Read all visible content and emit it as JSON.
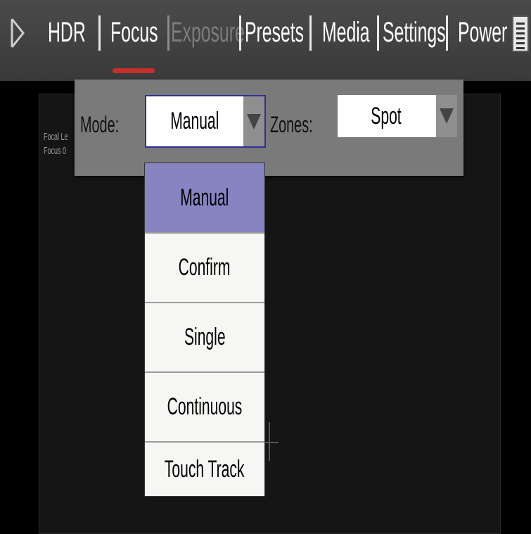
{
  "nav": {
    "items": [
      {
        "label": "HDR",
        "enabled": true
      },
      {
        "label": "Focus",
        "enabled": true,
        "active": true
      },
      {
        "label": "Exposure",
        "enabled": false
      },
      {
        "label": "Presets",
        "enabled": true
      },
      {
        "label": "Media",
        "enabled": true
      },
      {
        "label": "Settings",
        "enabled": true
      },
      {
        "label": "Power",
        "enabled": true
      }
    ],
    "active_indicator_color": "#c4302b"
  },
  "info": {
    "line1": "Focal Le",
    "line2": "Focus 0"
  },
  "panel": {
    "mode_label": "Mode:",
    "mode_value": "Manual",
    "zones_label": "Zones:",
    "zones_value": "Spot"
  },
  "dropdown": {
    "options": [
      "Manual",
      "Confirm",
      "Single",
      "Continuous",
      "Touch Track"
    ],
    "selected": "Manual",
    "selected_color": "#8784c2"
  },
  "icons": {
    "left": "play-arrow-icon",
    "right": "menu-icon",
    "dropdown": "triangle-down-icon"
  }
}
